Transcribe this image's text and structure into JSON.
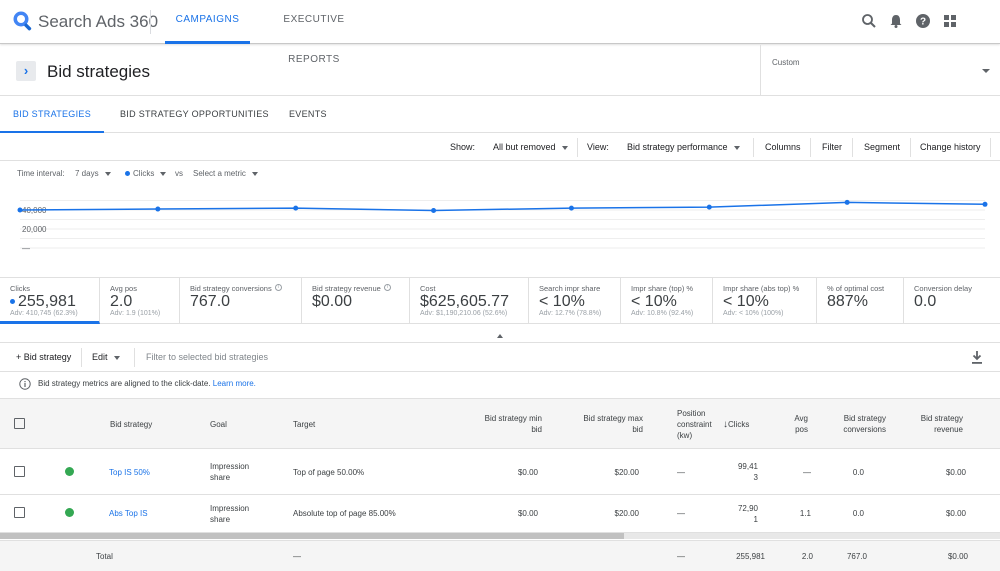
{
  "app": {
    "title": "Search Ads 360"
  },
  "nav": {
    "tabs": [
      {
        "label": "CAMPAIGNS"
      },
      {
        "label": "EXECUTIVE REPORTS"
      }
    ]
  },
  "header": {
    "title": "Bid strategies",
    "date_range_label": "Custom"
  },
  "subtabs": [
    {
      "label": "BID STRATEGIES"
    },
    {
      "label": "BID STRATEGY OPPORTUNITIES"
    },
    {
      "label": "EVENTS"
    }
  ],
  "toolbar": {
    "show_label": "Show:",
    "show_value": "All but removed",
    "view_label": "View:",
    "view_value": "Bid strategy performance",
    "columns": "Columns",
    "filter": "Filter",
    "segment": "Segment",
    "change_history": "Change history"
  },
  "chart_controls": {
    "time_interval_label": "Time interval:",
    "interval": "7 days",
    "metric": "Clicks",
    "vs": "vs",
    "compare_metric": "Select a metric"
  },
  "chart_data": {
    "type": "line",
    "series": [
      {
        "name": "Clicks",
        "color": "#1a73e8",
        "values": [
          40000,
          41000,
          42000,
          39500,
          42000,
          43000,
          48000,
          46000
        ]
      }
    ],
    "ytick_labels": [
      "40,000",
      "20,000",
      "—"
    ],
    "grid": true
  },
  "scorecards": [
    {
      "label": "Clicks",
      "value": "255,981",
      "sub": "Adv: 410,745 (62.3%)",
      "selected": true
    },
    {
      "label": "Avg pos",
      "value": "2.0",
      "sub": "Adv: 1.9 (101%)"
    },
    {
      "label": "Bid strategy conversions",
      "value": "767.0",
      "sub": ""
    },
    {
      "label": "Bid strategy revenue",
      "value": "$0.00",
      "sub": ""
    },
    {
      "label": "Cost",
      "value": "$625,605.77",
      "sub": "Adv: $1,190,210.06 (52.6%)"
    },
    {
      "label": "Search impr share",
      "value": "< 10%",
      "sub": "Adv: 12.7% (78.8%)"
    },
    {
      "label": "Impr share (top) %",
      "value": "< 10%",
      "sub": "Adv: 10.8% (92.4%)"
    },
    {
      "label": "Impr share (abs top) %",
      "value": "< 10%",
      "sub": "Adv: < 10% (100%)"
    },
    {
      "label": "% of optimal cost",
      "value": "887%",
      "sub": ""
    },
    {
      "label": "Conversion delay",
      "value": "0.0",
      "sub": ""
    }
  ],
  "actions": {
    "add": "+ Bid strategy",
    "edit": "Edit",
    "filter_placeholder": "Filter to selected bid strategies"
  },
  "notice": {
    "text": "Bid strategy metrics are aligned to the click-date.",
    "link": "Learn more."
  },
  "table": {
    "headers": {
      "bid_strategy": "Bid strategy",
      "goal": "Goal",
      "target": "Target",
      "min_bid_1": "Bid strategy min",
      "min_bid_2": "bid",
      "max_bid_1": "Bid strategy max",
      "max_bid_2": "bid",
      "pos_1": "Position",
      "pos_2": "constraint",
      "pos_3": "(kw)",
      "clicks": "Clicks",
      "avgpos_1": "Avg",
      "avgpos_2": "pos",
      "conv_1": "Bid strategy",
      "conv_2": "conversions",
      "rev_1": "Bid strategy",
      "rev_2": "revenue"
    },
    "rows": [
      {
        "name": "Top IS 50%",
        "goal_1": "Impression",
        "goal_2": "share",
        "target": "Top of page 50.00%",
        "min_bid": "$0.00",
        "max_bid": "$20.00",
        "pos": "—",
        "clicks_1": "99,41",
        "clicks_2": "3",
        "avg_pos": "—",
        "conversions": "0.0",
        "revenue": "$0.00"
      },
      {
        "name": "Abs Top IS",
        "goal_1": "Impression",
        "goal_2": "share",
        "target": "Absolute top of page 85.00%",
        "min_bid": "$0.00",
        "max_bid": "$20.00",
        "pos": "—",
        "clicks_1": "72,90",
        "clicks_2": "1",
        "avg_pos": "1.1",
        "conversions": "0.0",
        "revenue": "$0.00"
      }
    ],
    "total": {
      "label": "Total",
      "target": "—",
      "pos": "—",
      "clicks": "255,981",
      "avg_pos": "2.0",
      "conversions": "767.0",
      "revenue": "$0.00"
    }
  }
}
